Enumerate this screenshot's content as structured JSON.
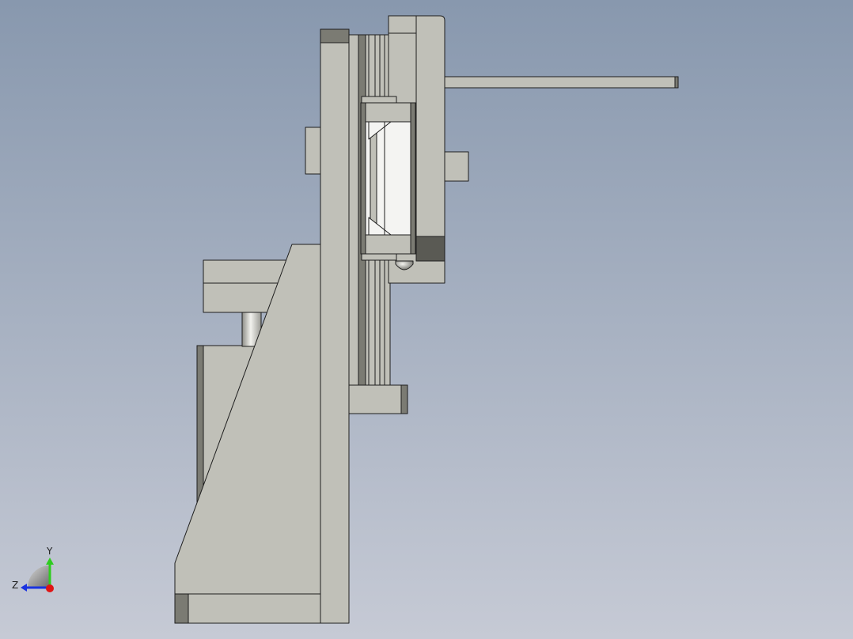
{
  "viewport": {
    "background_top": "#8898ae",
    "background_bottom": "#c6cad5"
  },
  "model": {
    "face_color": "#c0c0b8",
    "shadow_color": "#7b7b73",
    "dark_color": "#5a5a54",
    "edge_color": "#1e1e1e",
    "highlight_color": "#f4f4f2"
  },
  "triad": {
    "y_label": "Y",
    "z_label": "Z",
    "y_color": "#2ecc1f",
    "z_color": "#1a33e0",
    "x_color": "#e01414"
  }
}
